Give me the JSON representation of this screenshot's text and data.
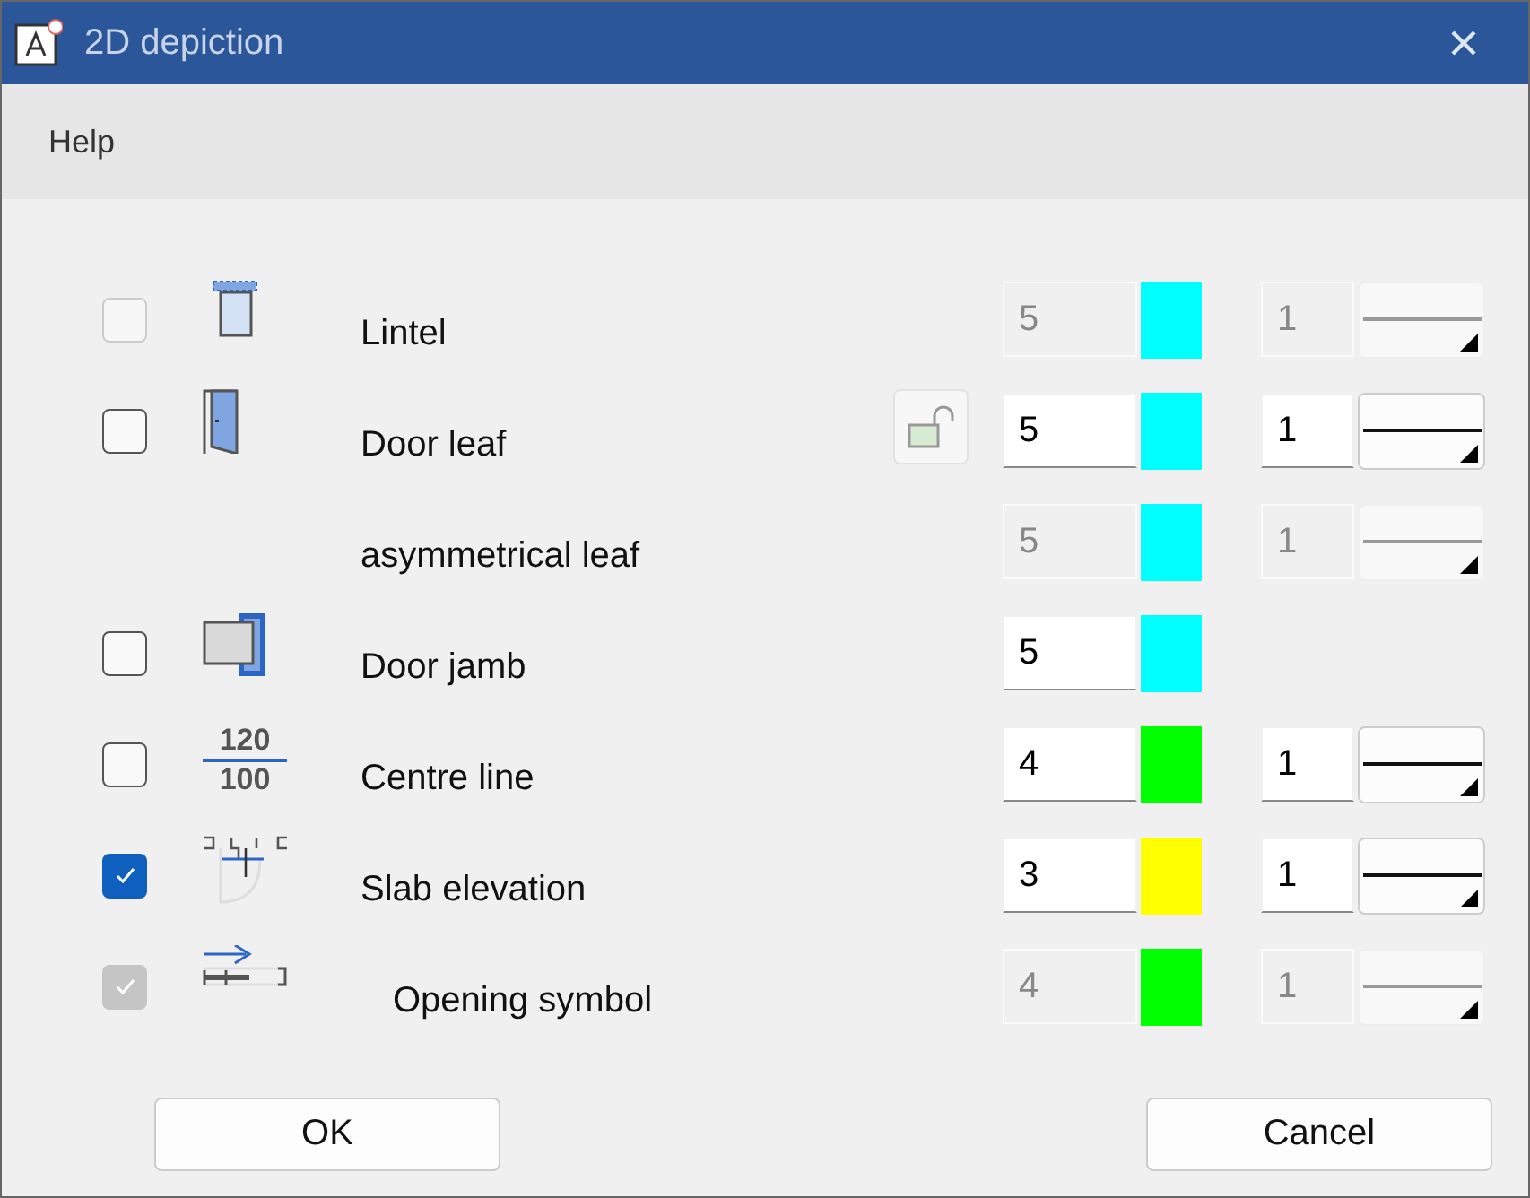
{
  "window": {
    "title": "2D depiction"
  },
  "menu": [
    "Help"
  ],
  "rows": [
    {
      "checkbox": {
        "checked": false,
        "disabled": true
      },
      "kind": "lintel",
      "label": "Lintel",
      "indented": false,
      "lock": false,
      "pen": {
        "value": "5",
        "disabled": true
      },
      "color": "#00ffff",
      "line": {
        "value": "1",
        "disabled": true
      }
    },
    {
      "checkbox": {
        "checked": false,
        "disabled": false
      },
      "kind": "door-leaf",
      "label": "Door leaf",
      "indented": false,
      "lock": true,
      "pen": {
        "value": "5",
        "disabled": false
      },
      "color": "#00ffff",
      "line": {
        "value": "1",
        "disabled": false
      }
    },
    {
      "label": "asymmetrical leaf",
      "indented": false,
      "lock": false,
      "pen": {
        "value": "5",
        "disabled": true
      },
      "color": "#00ffff",
      "line": {
        "value": "1",
        "disabled": true
      }
    },
    {
      "checkbox": {
        "checked": false,
        "disabled": false
      },
      "kind": "door-jamb",
      "label": "Door jamb",
      "indented": false,
      "lock": false,
      "pen": {
        "value": "5",
        "disabled": false
      },
      "color": "#00ffff"
    },
    {
      "checkbox": {
        "checked": false,
        "disabled": false
      },
      "kind": "fraction",
      "icon_text": [
        "120",
        "100"
      ],
      "label": "Centre line",
      "indented": false,
      "lock": false,
      "pen": {
        "value": "4",
        "disabled": false
      },
      "color": "#00ff00",
      "line": {
        "value": "1",
        "disabled": false
      }
    },
    {
      "checkbox": {
        "checked": true,
        "disabled": false
      },
      "kind": "slab",
      "label": "Slab elevation",
      "indented": false,
      "lock": false,
      "pen": {
        "value": "3",
        "disabled": false
      },
      "color": "#ffff00",
      "line": {
        "value": "1",
        "disabled": false
      }
    },
    {
      "checkbox": {
        "checked": true,
        "disabled": true
      },
      "kind": "opening",
      "label": "Opening symbol",
      "indented": true,
      "lock": false,
      "pen": {
        "value": "4",
        "disabled": true
      },
      "color": "#00ff00",
      "line": {
        "value": "1",
        "disabled": true
      }
    }
  ],
  "buttons": [
    "OK",
    "Cancel"
  ]
}
